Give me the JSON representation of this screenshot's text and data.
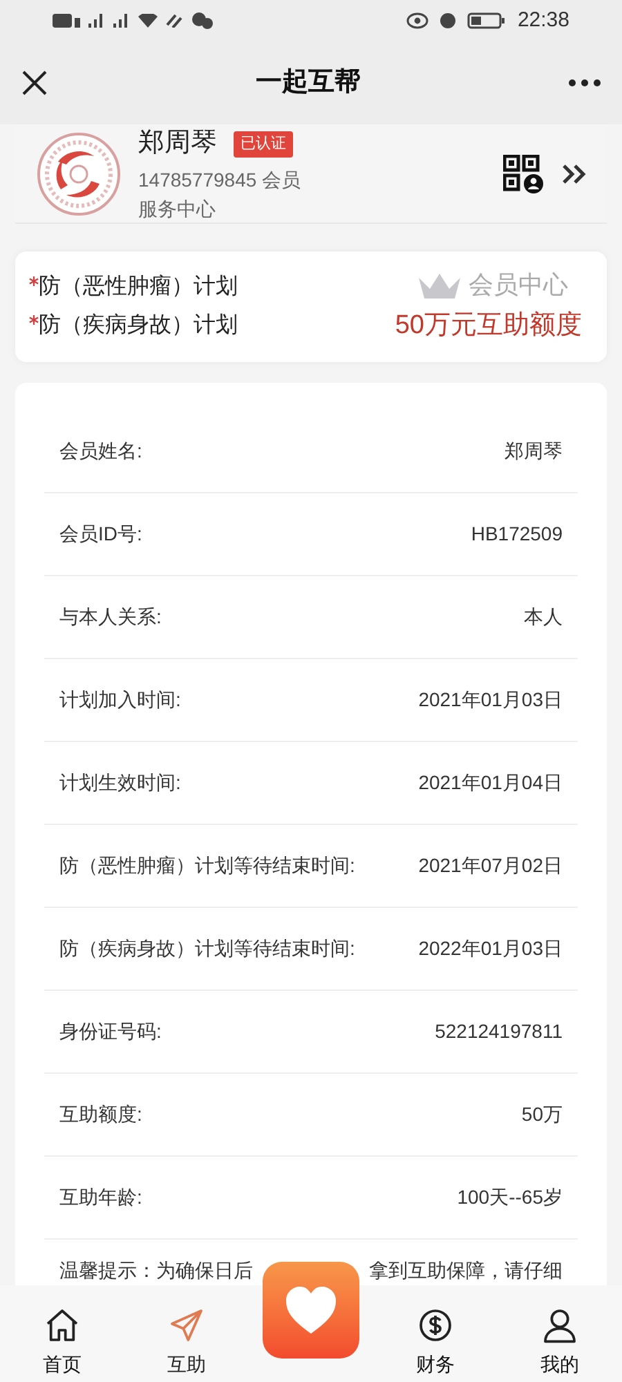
{
  "status_bar": {
    "time": "22:38"
  },
  "nav": {
    "title": "一起互帮"
  },
  "profile": {
    "name": "郑周琴",
    "badge": "已认证",
    "phone_line": "14785779845 会员",
    "sub_line": "服务中心"
  },
  "plans": {
    "items": [
      "防（恶性肿瘤）计划",
      "防（疾病身故）计划"
    ],
    "member_center": "会员中心",
    "amount": "50万元互助额度"
  },
  "details": [
    {
      "label": "会员姓名:",
      "value": "郑周琴"
    },
    {
      "label": "会员ID号:",
      "value": "HB172509"
    },
    {
      "label": "与本人关系:",
      "value": "本人"
    },
    {
      "label": "计划加入时间:",
      "value": "2021年01月03日"
    },
    {
      "label": "计划生效时间:",
      "value": "2021年01月04日"
    },
    {
      "label": "防（恶性肿瘤）计划等待结束时间:",
      "value": "2021年07月02日"
    },
    {
      "label": "防（疾病身故）计划等待结束时间:",
      "value": "2022年01月03日"
    },
    {
      "label": "身份证号码:",
      "value": "522124197811"
    },
    {
      "label": "互助额度:",
      "value": "50万"
    },
    {
      "label": "互助年龄:",
      "value": "100天--65岁"
    }
  ],
  "tip": {
    "before": "温馨提示：为确保日后",
    "after": "拿到互助保障，请仔细"
  },
  "tabs": [
    {
      "kind": "home",
      "label": "首页",
      "selected": false
    },
    {
      "kind": "send",
      "label": "互助",
      "selected": true
    },
    {
      "kind": "center"
    },
    {
      "kind": "money",
      "label": "财务",
      "selected": false
    },
    {
      "kind": "user",
      "label": "我的",
      "selected": false
    }
  ]
}
